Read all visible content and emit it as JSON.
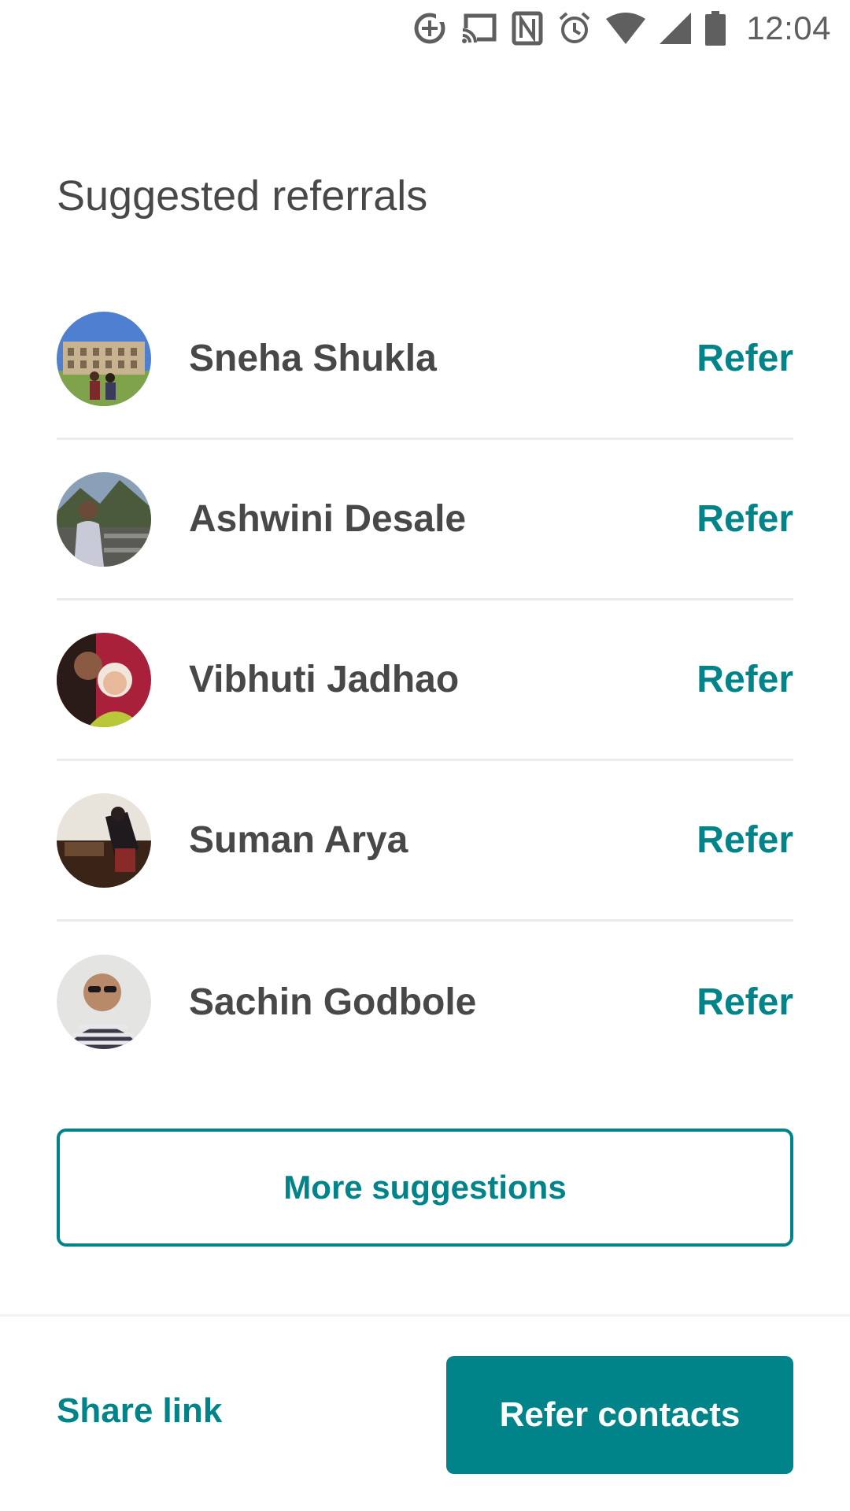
{
  "status_bar": {
    "time": "12:04",
    "icons": [
      "data-saver-icon",
      "cast-icon",
      "nfc-icon",
      "alarm-icon",
      "wifi-icon",
      "signal-icon",
      "battery-icon"
    ]
  },
  "page": {
    "title": "Suggested referrals"
  },
  "referrals": [
    {
      "name": "Sneha Shukla",
      "action": "Refer"
    },
    {
      "name": "Ashwini Desale",
      "action": "Refer"
    },
    {
      "name": "Vibhuti Jadhao",
      "action": "Refer"
    },
    {
      "name": "Suman Arya",
      "action": "Refer"
    },
    {
      "name": "Sachin Godbole",
      "action": "Refer"
    }
  ],
  "more_button": {
    "label": "More suggestions"
  },
  "footer": {
    "share_label": "Share link",
    "refer_contacts_label": "Refer contacts"
  },
  "colors": {
    "accent": "#008489",
    "text": "#484848",
    "divider": "#ebebeb"
  }
}
